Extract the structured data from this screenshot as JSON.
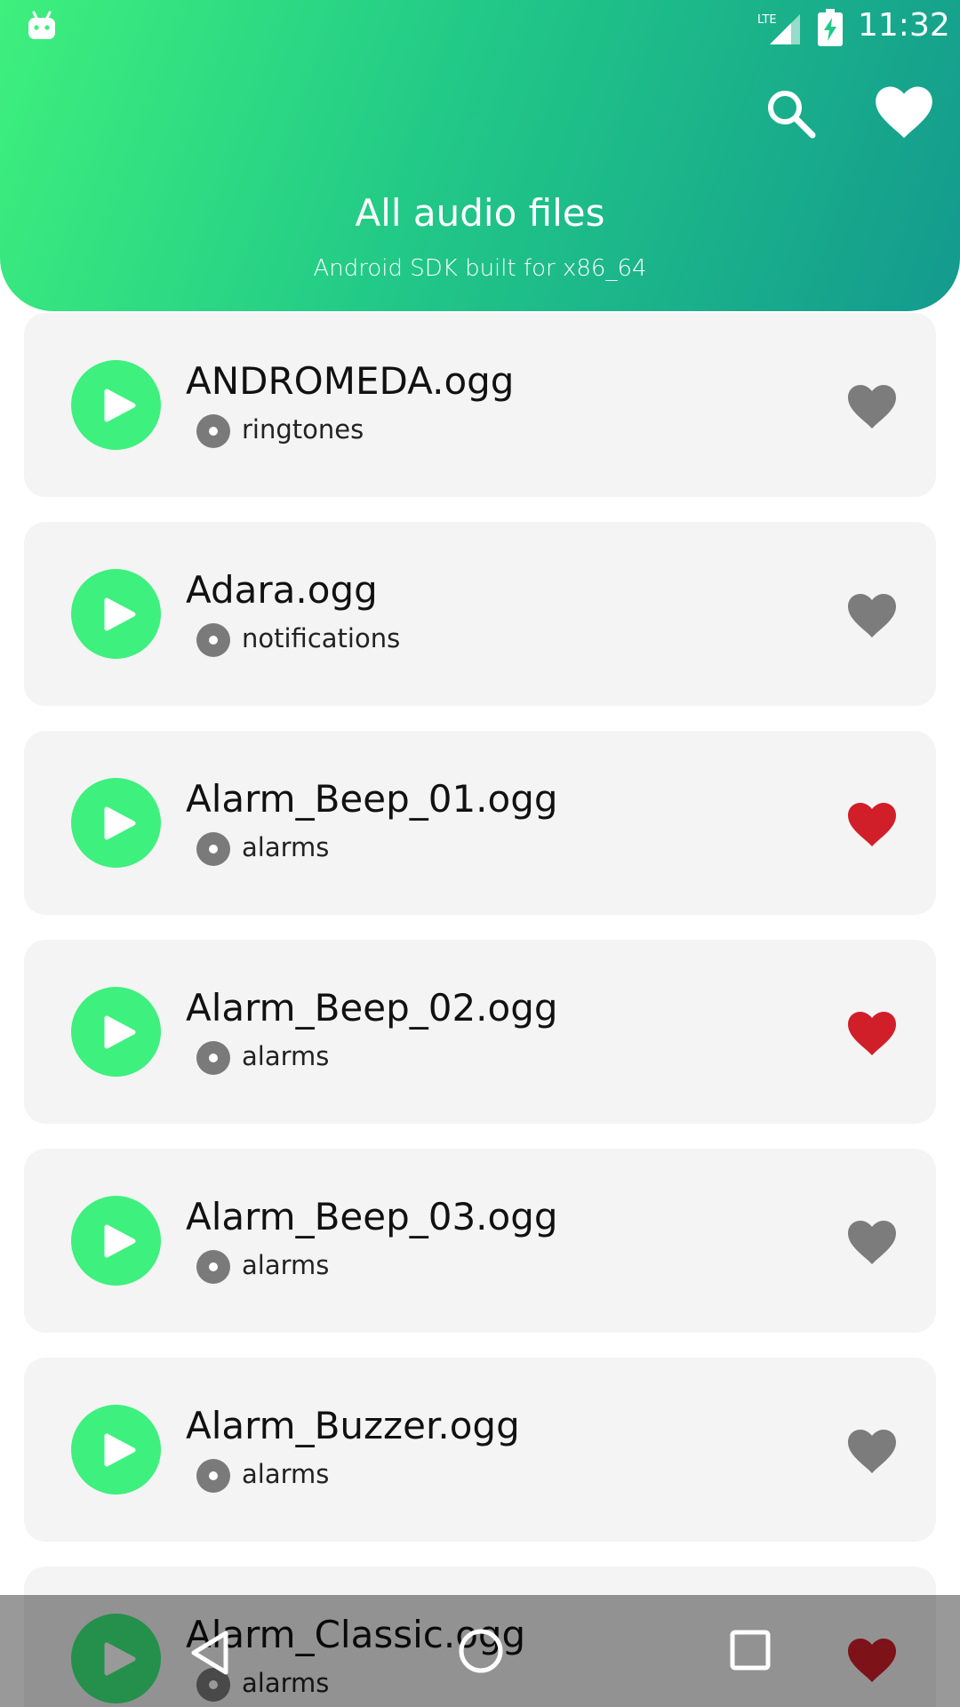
{
  "status_bar": {
    "time": "11:32",
    "network": "LTE"
  },
  "header": {
    "title": "All audio files",
    "subtitle": "Android SDK built for x86_64"
  },
  "colors": {
    "accent": "#3ef07d",
    "favorite_active": "#d11f2a",
    "favorite_inactive": "#7c7c7c"
  },
  "audio_files": [
    {
      "name": "ANDROMEDA.ogg",
      "folder": "ringtones",
      "favorite": false
    },
    {
      "name": "Adara.ogg",
      "folder": "notifications",
      "favorite": false
    },
    {
      "name": "Alarm_Beep_01.ogg",
      "folder": "alarms",
      "favorite": true
    },
    {
      "name": "Alarm_Beep_02.ogg",
      "folder": "alarms",
      "favorite": true
    },
    {
      "name": "Alarm_Beep_03.ogg",
      "folder": "alarms",
      "favorite": false
    },
    {
      "name": "Alarm_Buzzer.ogg",
      "folder": "alarms",
      "favorite": false
    },
    {
      "name": "Alarm_Classic.ogg",
      "folder": "alarms",
      "favorite": true
    }
  ],
  "icons": {
    "header_search": "search-icon",
    "header_favorites": "heart-icon",
    "play": "play-icon",
    "folder": "disc-icon",
    "favorite": "heart-icon",
    "nav_back": "back-icon",
    "nav_home": "home-icon",
    "nav_recents": "recents-icon"
  }
}
